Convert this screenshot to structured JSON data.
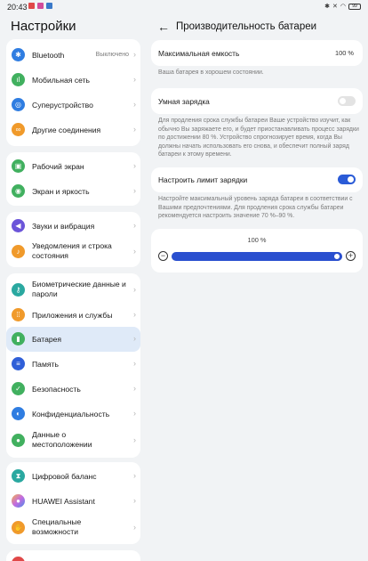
{
  "status_bar": {
    "time": "20:43",
    "battery": "99",
    "icons": [
      "notification-icon",
      "app-icon",
      "app-icon",
      "bluetooth-icon",
      "mute-icon",
      "wifi-icon",
      "battery-icon"
    ]
  },
  "left": {
    "title": "Настройки",
    "groups": [
      {
        "items": [
          {
            "label": "Bluetooth",
            "value": "Выключено",
            "icon": "bluetooth-icon",
            "color": "#2f7de1"
          },
          {
            "label": "Мобильная сеть",
            "icon": "signal-icon",
            "color": "#41b05f"
          },
          {
            "label": "Суперустройство",
            "icon": "devices-icon",
            "color": "#2f7de1"
          },
          {
            "label": "Другие соединения",
            "icon": "link-icon",
            "color": "#f09a2b"
          }
        ]
      },
      {
        "items": [
          {
            "label": "Рабочий экран",
            "icon": "home-screen-icon",
            "color": "#41b05f"
          },
          {
            "label": "Экран и яркость",
            "icon": "eye-icon",
            "color": "#41b05f"
          }
        ]
      },
      {
        "items": [
          {
            "label": "Звуки и вибрация",
            "icon": "sound-icon",
            "color": "#6b55d9"
          },
          {
            "label": "Уведомления и строка состояния",
            "icon": "bell-icon",
            "color": "#f09a2b"
          }
        ]
      },
      {
        "items": [
          {
            "label": "Биометрические данные и пароли",
            "icon": "key-icon",
            "color": "#2aa8a0"
          },
          {
            "label": "Приложения и службы",
            "icon": "apps-icon",
            "color": "#f09a2b"
          },
          {
            "label": "Батарея",
            "icon": "battery-icon",
            "color": "#41b05f",
            "active": true
          },
          {
            "label": "Память",
            "icon": "storage-icon",
            "color": "#2f5fd8"
          },
          {
            "label": "Безопасность",
            "icon": "shield-icon",
            "color": "#41b05f"
          },
          {
            "label": "Конфиденциальность",
            "icon": "privacy-icon",
            "color": "#2f7de1"
          },
          {
            "label": "Данные о местоположении",
            "icon": "location-icon",
            "color": "#41b05f"
          }
        ]
      },
      {
        "items": [
          {
            "label": "Цифровой баланс",
            "icon": "hourglass-icon",
            "color": "#2aa8a0"
          },
          {
            "label": "HUAWEI Assistant",
            "icon": "assistant-icon",
            "color": "#c56be0"
          },
          {
            "label": "Специальные возможности",
            "icon": "accessibility-icon",
            "color": "#f09a2b"
          }
        ]
      }
    ]
  },
  "right": {
    "title": "Производительность батареи",
    "max_capacity": {
      "label": "Максимальная емкость",
      "value": "100 %"
    },
    "capacity_hint": "Ваша батарея в хорошем состоянии.",
    "smart_charge": {
      "label": "Умная зарядка",
      "enabled": false
    },
    "smart_charge_hint": "Для продления срока службы батареи Ваше устройство изучит, как обычно Вы заряжаете его, и будет приостанавливать процесс зарядки по достижении 80 %. Устройство спрогнозирует время, когда Вы должны начать использовать его снова, и обеспечит полный заряд батареи к этому времени.",
    "charge_limit": {
      "label": "Настроить лимит зарядки",
      "enabled": true
    },
    "charge_limit_hint": "Настройте максимальный уровень заряда батареи в соответствии с Вашими предпочтениями. Для продления срока службы батареи рекомендуется настроить значение 70 %–90 %.",
    "slider": {
      "value_label": "100 %",
      "value": 100,
      "min_icon": "minus-icon",
      "max_icon": "plus-icon"
    }
  }
}
